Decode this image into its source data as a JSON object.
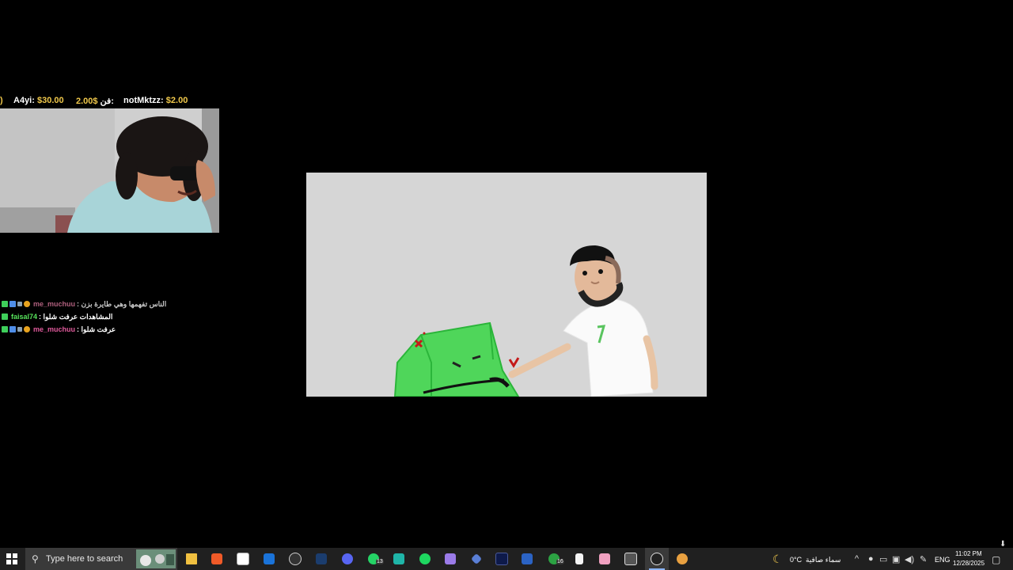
{
  "ticker": {
    "donations": [
      {
        "name": "A4yi:",
        "amount": "$30.00"
      },
      {
        "name": "فن:",
        "amount": "2.00$"
      },
      {
        "name": "notMktzz:",
        "amount": "$2.00"
      }
    ]
  },
  "chat": {
    "messages": [
      {
        "user": "me_muchuu",
        "text": ": الناس تفهمها وهي طايرة بزن",
        "user_color": "#e05a9c"
      },
      {
        "user": "faisal74",
        "text": ": المشاهدات عرفت شلوا",
        "user_color": "#57e35b"
      },
      {
        "user": "me_muchuu",
        "text": ": عرفت شلوا",
        "user_color": "#e05a9c"
      }
    ]
  },
  "taskbar": {
    "search_placeholder": "Type here to search",
    "whatsapp_badge": "13",
    "xbox_badge": "16",
    "weather_temp": "0°C",
    "weather_text": "سماء صافية",
    "language": "ENG",
    "time": "11:02 PM",
    "date": "12/28/2025"
  },
  "colors": {
    "taskbar_bg": "#202020",
    "canvas_bg": "#d6d6d6",
    "donation_amount": "#f0c84b",
    "cube_green": "#4fd65a"
  },
  "icons": [
    "windows-start-icon",
    "search-icon",
    "file-explorer-icon",
    "brave-icon",
    "store-icon",
    "outlook-icon",
    "jump-icon",
    "steam-icon",
    "discord-icon",
    "whatsapp-icon",
    "tasks-icon",
    "spotify-icon",
    "gamepad-icon",
    "network-icon",
    "terminal-icon",
    "word-icon",
    "xbox-icon",
    "notepad-icon",
    "anime-app-icon",
    "capture-icon",
    "obs-icon",
    "game-icon"
  ]
}
